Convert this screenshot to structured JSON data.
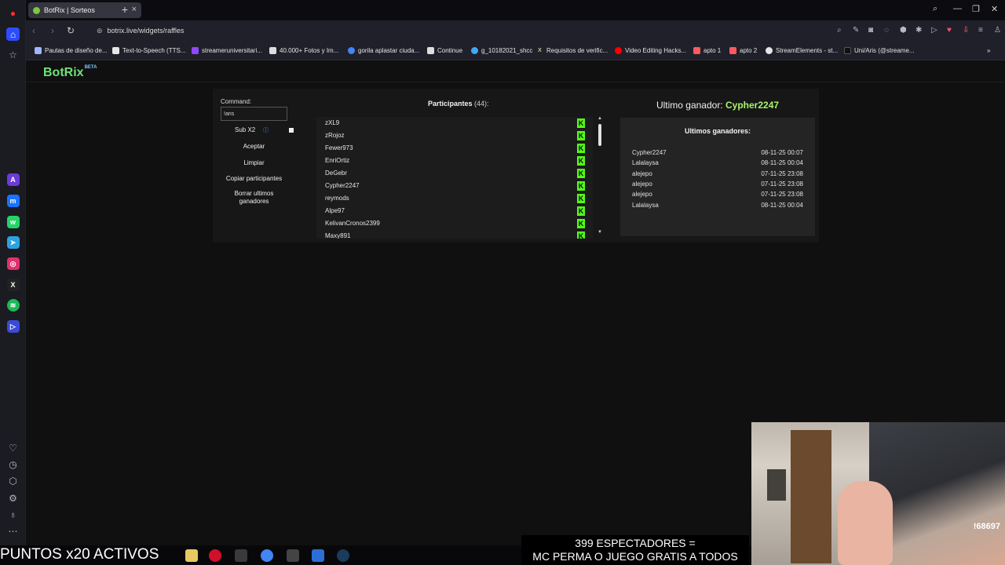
{
  "tab": {
    "title": "BotRix | Sorteos"
  },
  "address": {
    "url": "botrix.live/widgets/raffles"
  },
  "bookmarks": [
    "Pautas de diseño de...",
    "Text-to-Speech (TTS...",
    "streameruniversitari...",
    "40.000+ Fotos y Im...",
    "gorila aplastar ciuda...",
    "Continue",
    "g_10182021_shcc",
    "Requisitos de verific...",
    "Video Editing Hacks...",
    "apto 1",
    "apto 2",
    "StreamElements - st...",
    "Uni/Aris (@streame..."
  ],
  "brand": {
    "name": "BotRix",
    "tag": "BETA"
  },
  "controls": {
    "command_label": "Command:",
    "command_value": "!aris",
    "sub_label": "Sub X2",
    "accept": "Aceptar",
    "clear": "Limpiar",
    "copy": "Copiar participantes",
    "delete_line1": "Borrar ultimos",
    "delete_line2": "ganadores"
  },
  "participants": {
    "title": "Participantes",
    "count": "(44):",
    "items": [
      "zXL9",
      "zRojoz",
      "Fewer973",
      "EnriOrtiz",
      "DeGebr",
      "Cypher2247",
      "reymods",
      "Alpe97",
      "KelivanCronos2399",
      "Maxy891"
    ],
    "badge": "K"
  },
  "winner": {
    "label": "Ultimo ganador:",
    "name": "Cypher2247",
    "list_title": "Ultimos ganadores:",
    "list": [
      {
        "name": "Cypher2247",
        "date": "08-11-25 00:07"
      },
      {
        "name": "Lalalaysa",
        "date": "08-11-25 00:04"
      },
      {
        "name": "alejepo",
        "date": "07-11-25 23:08"
      },
      {
        "name": "alejepo",
        "date": "07-11-25 23:08"
      },
      {
        "name": "alejepo",
        "date": "07-11-25 23:08"
      },
      {
        "name": "Lalalaysa",
        "date": "08-11-25 00:04"
      }
    ]
  },
  "overlay": {
    "points": "PUNTOS x20 ACTIVOS",
    "viewers_line1": "399 ESPECTADORES =",
    "viewers_line2": "MC PERMA O JUEGO GRATIS A TODOS",
    "cam_code": "!68697"
  },
  "colors": {
    "accent": "#6ee17a",
    "kick": "#53fc18",
    "winner": "#a8f46c"
  }
}
